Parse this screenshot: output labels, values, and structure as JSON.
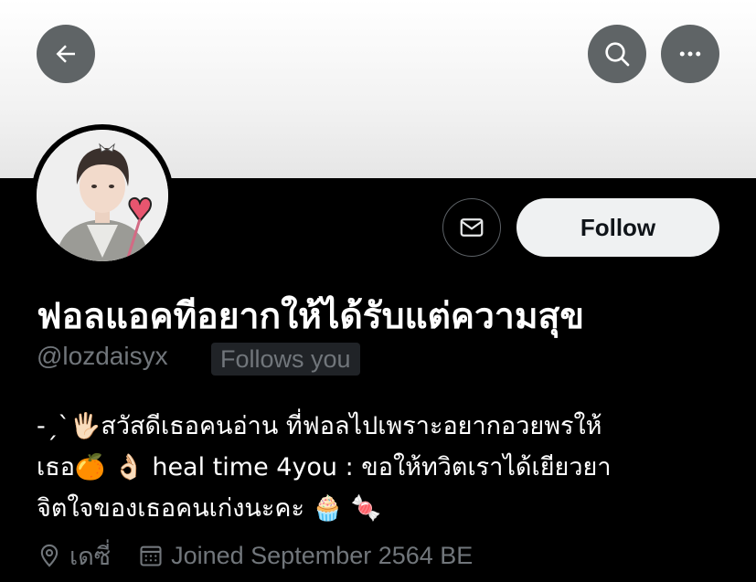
{
  "header": {
    "back_icon": "arrow-left-icon",
    "search_icon": "search-icon",
    "more_icon": "more-horizontal-icon"
  },
  "profile": {
    "display_name": "ฟอลแอคทีอยากให้ได้รับแต่ความสุข",
    "handle": "@lozdaisyx",
    "follows_you": "Follows you",
    "follow_label": "Follow",
    "message_icon": "envelope-icon",
    "bio_lines": [
      "-ˏˋ🖐🏻สวัสดีเธอคนอ่าน ที่ฟอลไปเพราะอยากอวยพรให้",
      "เธอ🍊 👌🏻 heal time 4you : ขอให้ทวิตเราได้เยียวยา",
      "จิตใจของเธอคนเก่งนะคะ 🧁 🍬"
    ],
    "location": "เดซี่",
    "joined": "Joined September 2564 BE"
  },
  "colors": {
    "background": "#000000",
    "button_grey": "#5f6466",
    "secondary_text": "#71767b",
    "follow_bg": "#eff1f2"
  }
}
